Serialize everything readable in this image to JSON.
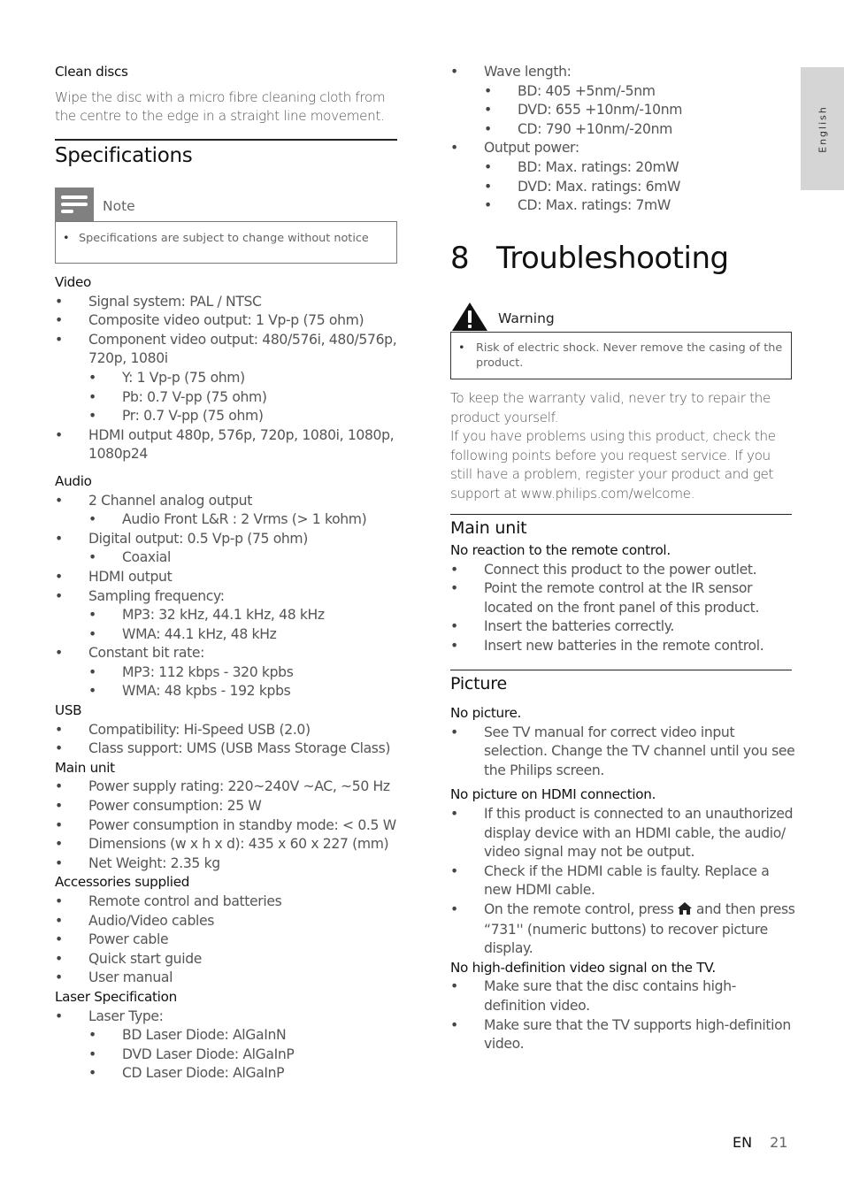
{
  "left": {
    "clean_discs": {
      "title": "Clean discs",
      "body": "Wipe the disc with a micro fibre cleaning cloth from the centre to the edge in a straight line movement."
    },
    "specifications": {
      "title": "Specifications",
      "note": {
        "label": "Note",
        "icon": "note-lines-icon",
        "text": "Specifications are subject to change without notice"
      },
      "video": {
        "title": "Video",
        "items": [
          {
            "text": "Signal system: PAL / NTSC"
          },
          {
            "text": "Composite video output: 1 Vp-p (75 ohm)"
          },
          {
            "text": "Component video output: 480/576i, 480/576p, 720p, 1080i",
            "sub": [
              "Y: 1 Vp-p (75 ohm)",
              "Pb: 0.7 V-pp (75 ohm)",
              "Pr: 0.7 V-pp (75 ohm)"
            ]
          },
          {
            "text": "HDMI output 480p, 576p, 720p, 1080i, 1080p, 1080p24"
          }
        ]
      },
      "audio": {
        "title": "Audio",
        "items": [
          {
            "text": "2 Channel analog output",
            "sub": [
              "Audio Front L&R : 2 Vrms (> 1 kohm)"
            ]
          },
          {
            "text": "Digital output: 0.5 Vp-p (75 ohm)",
            "sub": [
              "Coaxial"
            ]
          },
          {
            "text": "HDMI output"
          },
          {
            "text": "Sampling frequency:",
            "sub": [
              "MP3: 32 kHz, 44.1 kHz, 48 kHz",
              "WMA: 44.1 kHz, 48 kHz"
            ]
          },
          {
            "text": "Constant bit rate:",
            "sub": [
              "MP3: 112 kbps - 320 kpbs",
              "WMA: 48 kpbs - 192 kpbs"
            ]
          }
        ]
      },
      "usb": {
        "title": "USB",
        "items": [
          "Compatibility: Hi-Speed USB (2.0)",
          "Class support: UMS (USB Mass Storage Class)"
        ]
      },
      "main_unit": {
        "title": "Main unit",
        "items": [
          "Power supply rating: 220~240V ~AC, ~50 Hz",
          "Power consumption: 25 W",
          "Power consumption in standby mode: < 0.5 W",
          "Dimensions (w x h x d): 435 x 60 x 227 (mm)",
          "Net Weight: 2.35 kg"
        ]
      },
      "accessories": {
        "title": "Accessories supplied",
        "items": [
          "Remote control and batteries",
          "Audio/Video cables",
          "Power cable",
          "Quick start guide",
          "User manual"
        ]
      },
      "laser": {
        "title": "Laser Specification",
        "type_label": "Laser Type:",
        "types": [
          "BD Laser Diode: AlGaInN",
          "DVD Laser Diode: AlGaInP",
          "CD Laser Diode: AlGaInP"
        ],
        "wave_label": "Wave length:",
        "waves": [
          "BD: 405 +5nm/-5nm",
          "DVD: 655 +10nm/-10nm",
          "CD: 790 +10nm/-20nm"
        ],
        "power_label": "Output power:",
        "powers": [
          "BD: Max. ratings: 20mW",
          "DVD: Max. ratings: 6mW",
          "CD: Max. ratings: 7mW"
        ]
      }
    }
  },
  "right": {
    "chapter": {
      "number": "8",
      "title": "Troubleshooting"
    },
    "warning": {
      "label": "Warning",
      "icon": "warning-triangle-icon",
      "text": "Risk of electric shock. Never remove the casing of the product."
    },
    "intro1": "To keep the warranty valid, never try to repair the product yourself.",
    "intro2": "If you have problems using this product, check the following points before you request service. If you still have a problem, register your product and get support at www.philips.com/welcome.",
    "main_unit": {
      "title": "Main unit",
      "problem": "No reaction to the remote control.",
      "items": [
        "Connect this product to the power outlet.",
        "Point the remote control at the IR sensor located on the front panel of this product.",
        "Insert the batteries correctly.",
        "Insert new batteries in the remote control."
      ]
    },
    "picture": {
      "title": "Picture",
      "p1": {
        "problem": "No picture.",
        "items": [
          "See TV manual for correct video input selection. Change the TV channel until you see the Philips screen."
        ]
      },
      "p2": {
        "problem": "No picture on HDMI connection.",
        "items": [
          "If this product is connected to an unauthorized display device with an HDMI cable, the audio/ video signal may not be output.",
          "Check if the HDMI cable is faulty. Replace a new HDMI cable."
        ],
        "home_item_before": "On the remote control, press",
        "home_icon": "home-icon",
        "home_item_after": "and then press “731'' (numeric buttons) to recover picture display."
      },
      "p3": {
        "problem": "No high-definition video signal on the TV.",
        "items": [
          "Make sure that the disc contains high-definition video.",
          "Make sure that the TV supports high-definition video."
        ]
      }
    }
  },
  "side_tab": {
    "label": "English"
  },
  "footer": {
    "lang": "EN",
    "page": "21"
  }
}
